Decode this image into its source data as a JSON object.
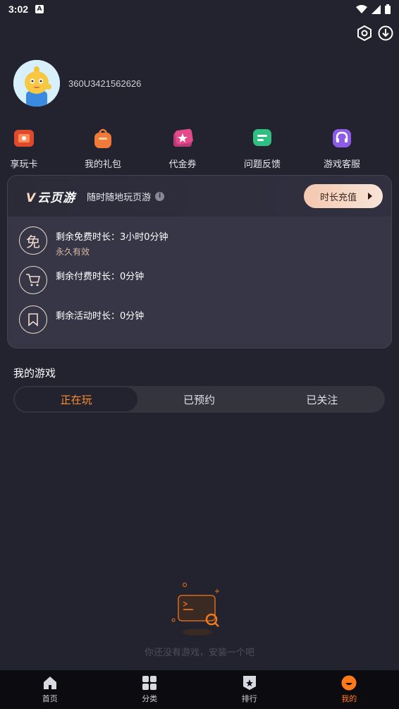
{
  "status_bar": {
    "time": "3:02",
    "notif_letter": "A"
  },
  "profile": {
    "username": "360U3421562626"
  },
  "quick_actions": [
    {
      "label": "享玩卡",
      "icon": "play-card-icon",
      "color": "#e04a2c"
    },
    {
      "label": "我的礼包",
      "icon": "gift-bag-icon",
      "color": "#ef7a3a"
    },
    {
      "label": "代金券",
      "icon": "coupon-icon",
      "color": "#e24a8a"
    },
    {
      "label": "问题反馈",
      "icon": "feedback-icon",
      "color": "#2fbf80"
    },
    {
      "label": "游戏客服",
      "icon": "headset-icon",
      "color": "#8e5be8"
    }
  ],
  "cloud": {
    "brand_v": "V",
    "brand": "云页游",
    "slogan": "随时随地玩页游",
    "info": "i",
    "recharge_label": "时长充值",
    "rows": [
      {
        "icon_text": "免",
        "main": "剩余免费时长：3小时0分钟",
        "sub": "永久有效"
      },
      {
        "icon_text": "",
        "main": "剩余付费时长：0分钟",
        "sub": ""
      },
      {
        "icon_text": "",
        "main": "剩余活动时长：0分钟",
        "sub": ""
      }
    ]
  },
  "my_games": {
    "title": "我的游戏",
    "tabs": [
      "正在玩",
      "已预约",
      "已关注"
    ],
    "active_tab": 0,
    "empty_hint": "你还没有游戏，安装一个吧"
  },
  "tabbar": {
    "items": [
      "首页",
      "分类",
      "排行",
      "我的"
    ],
    "active": 3
  },
  "colors": {
    "accent": "#ff7a1a",
    "background": "#23232f"
  }
}
